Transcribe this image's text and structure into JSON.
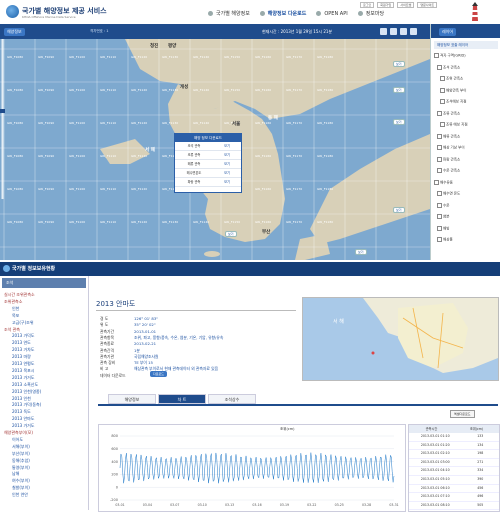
{
  "header": {
    "title": "국가별 해양정보 제공 서비스",
    "subtitle": "KHOA Offshore Marine Data Service",
    "nav": [
      {
        "label": "국가별 해양정보",
        "active": false
      },
      {
        "label": "해양정보 다운로드",
        "active": true
      },
      {
        "label": "OPEN API",
        "active": false
      },
      {
        "label": "정보마당",
        "active": false
      }
    ],
    "links": [
      "로그인",
      "회원가입",
      "사이트맵",
      "영문사이트"
    ]
  },
  "mapbar": {
    "tab": "해양정보",
    "sub": "격자번호 : 1",
    "time": "현재시간 : 2013년 1월 29일 15시 21분"
  },
  "map": {
    "places": [
      {
        "text": "청진"
      },
      {
        "text": "평양"
      },
      {
        "text": "서울"
      },
      {
        "text": "부산"
      },
      {
        "text": "동 해"
      },
      {
        "text": "서 해"
      },
      {
        "text": "개성"
      },
      {
        "text": "대한민국"
      }
    ],
    "grid_cols": [
      "GRI_F1080",
      "GRI_F1090",
      "GRI_F1100",
      "GRI_F1110",
      "GRI_F1120",
      "GRI_F1130",
      "GRI_F1140",
      "GRI_F1150",
      "GRI_F1160",
      "GRI_F1170",
      "GRI_F1180"
    ],
    "grid_rows": 6,
    "popup": {
      "title": "해양 정보 다운로드",
      "rows": [
        {
          "k": "조석 관측",
          "v": "보기"
        },
        {
          "k": "조류 관측",
          "v": "보기"
        },
        {
          "k": "해류 관측",
          "v": "보기"
        },
        {
          "k": "해수면온도",
          "v": "보기"
        },
        {
          "k": "파랑 관측",
          "v": "보기"
        }
      ]
    },
    "pills": [
      "보기",
      "보기",
      "보기",
      "보기",
      "보기",
      "보기"
    ]
  },
  "right_panel": {
    "head": "레이어",
    "sub": "해양정보 표출 레이어",
    "items": [
      "격자 구역(GRID)",
      "조석 관측소",
      "조위 관측소",
      "해양관측 부이",
      "조석예보 지점",
      "조류 관측소",
      "조류 예보 지점",
      "해류 관측소",
      "해상 기상 부이",
      "파랑 관측소",
      "수온 관측소",
      "해수유동",
      "해수면 온도",
      "수온",
      "염분",
      "해빙",
      "해상풍"
    ]
  },
  "dashboard": {
    "title": "국가별 정보보유현황",
    "left_head": "조석",
    "tree": [
      {
        "text": "실시간 조위관측소",
        "type": "cat"
      },
      {
        "text": "조위관측소",
        "type": "cat"
      },
      {
        "text": "인천",
        "type": "item"
      },
      {
        "text": "목포",
        "type": "item"
      },
      {
        "text": "고금(구)조위",
        "type": "item"
      },
      {
        "text": "조석 관측",
        "type": "cat"
      },
      {
        "text": "2013 가덕도",
        "type": "item"
      },
      {
        "text": "2013 연도",
        "type": "item"
      },
      {
        "text": "2013 거차도",
        "type": "item"
      },
      {
        "text": "2013 마량",
        "type": "item"
      },
      {
        "text": "2013 연평도",
        "type": "item"
      },
      {
        "text": "2013 목포시",
        "type": "item"
      },
      {
        "text": "2013 가거도",
        "type": "item"
      },
      {
        "text": "2013 소흑산도",
        "type": "item"
      },
      {
        "text": "2013 인천(영종)",
        "type": "item"
      },
      {
        "text": "2013 인천",
        "type": "item"
      },
      {
        "text": "2013 가덕(동측)",
        "type": "item"
      },
      {
        "text": "2013 독도",
        "type": "item"
      },
      {
        "text": "2013 안마도",
        "type": "item"
      },
      {
        "text": "2013 가거도",
        "type": "item"
      },
      {
        "text": "해양관측부이(모)",
        "type": "cat"
      },
      {
        "text": "이어도",
        "type": "item"
      },
      {
        "text": "서해(부이)",
        "type": "item"
      },
      {
        "text": "부산(부이)",
        "type": "item"
      },
      {
        "text": "동해(추암)",
        "type": "item"
      },
      {
        "text": "통영(부이)",
        "type": "item"
      },
      {
        "text": "남해",
        "type": "item"
      },
      {
        "text": "여수(부이)",
        "type": "item"
      },
      {
        "text": "칠발(부이)",
        "type": "item"
      },
      {
        "text": "인천 연안",
        "type": "item"
      }
    ],
    "station": {
      "title": "2013 안마도",
      "rows": [
        {
          "k": "경   도",
          "v": "126° 01' 83\""
        },
        {
          "k": "위   도",
          "v": "35° 20' 02\""
        },
        {
          "k": "관측기간",
          "v": "2013-01-01"
        },
        {
          "k": "관측항목",
          "v": "조위, 파고, 풍향/풍속, 수온, 염분, 기온, 기압, 유향/유속"
        },
        {
          "k": "관측종료",
          "v": "2013-02-21"
        },
        {
          "k": "관측간격",
          "v": "1분"
        },
        {
          "k": "관측기관",
          "v": "국립해양조사원"
        },
        {
          "k": "관측 장비",
          "v": "TE 부이 15"
        },
        {
          "k": "비   고",
          "v": "해상관측 부이로서 현재 관측데이터 외 관측자료 있음"
        },
        {
          "k": "데이터 다운로드",
          "v": ""
        }
      ],
      "download_label": "다운로드"
    },
    "tabs": [
      {
        "label": "해양정보",
        "active": false
      },
      {
        "label": "차 트",
        "active": true
      },
      {
        "label": "조석상수",
        "active": false
      }
    ],
    "excel_label": "엑셀다운로드",
    "table": {
      "headers": [
        "관측시간",
        "조위(cm)"
      ],
      "rows": [
        [
          "2013-03-01 01:10",
          "133"
        ],
        [
          "2013-03-01 01:20",
          "134"
        ],
        [
          "2013-03-01 02:10",
          "198"
        ],
        [
          "2013-03-01 03:00",
          "271"
        ],
        [
          "2013-03-01 04:10",
          "334"
        ],
        [
          "2013-03-01 05:10",
          "390"
        ],
        [
          "2013-03-01 06:10",
          "456"
        ],
        [
          "2013-03-01 07:10",
          "496"
        ],
        [
          "2013-03-01 08:10",
          "505"
        ],
        [
          "2013-03-01 09:10",
          "466"
        ]
      ]
    }
  },
  "chart_data": {
    "type": "line",
    "title": "",
    "legend": "조위(cm)",
    "ylim": [
      -200,
      800
    ],
    "yticks": [
      "800",
      "600",
      "400",
      "200",
      "0",
      "-200"
    ],
    "xticks": [
      "03-01",
      "03-04",
      "03-07",
      "03-10",
      "03-13",
      "03-16",
      "03-19",
      "03-22",
      "03-25",
      "03-28",
      "03-31"
    ],
    "x_count": 300,
    "amplitude": 240,
    "mean": 300,
    "color": "#1e78c8"
  }
}
